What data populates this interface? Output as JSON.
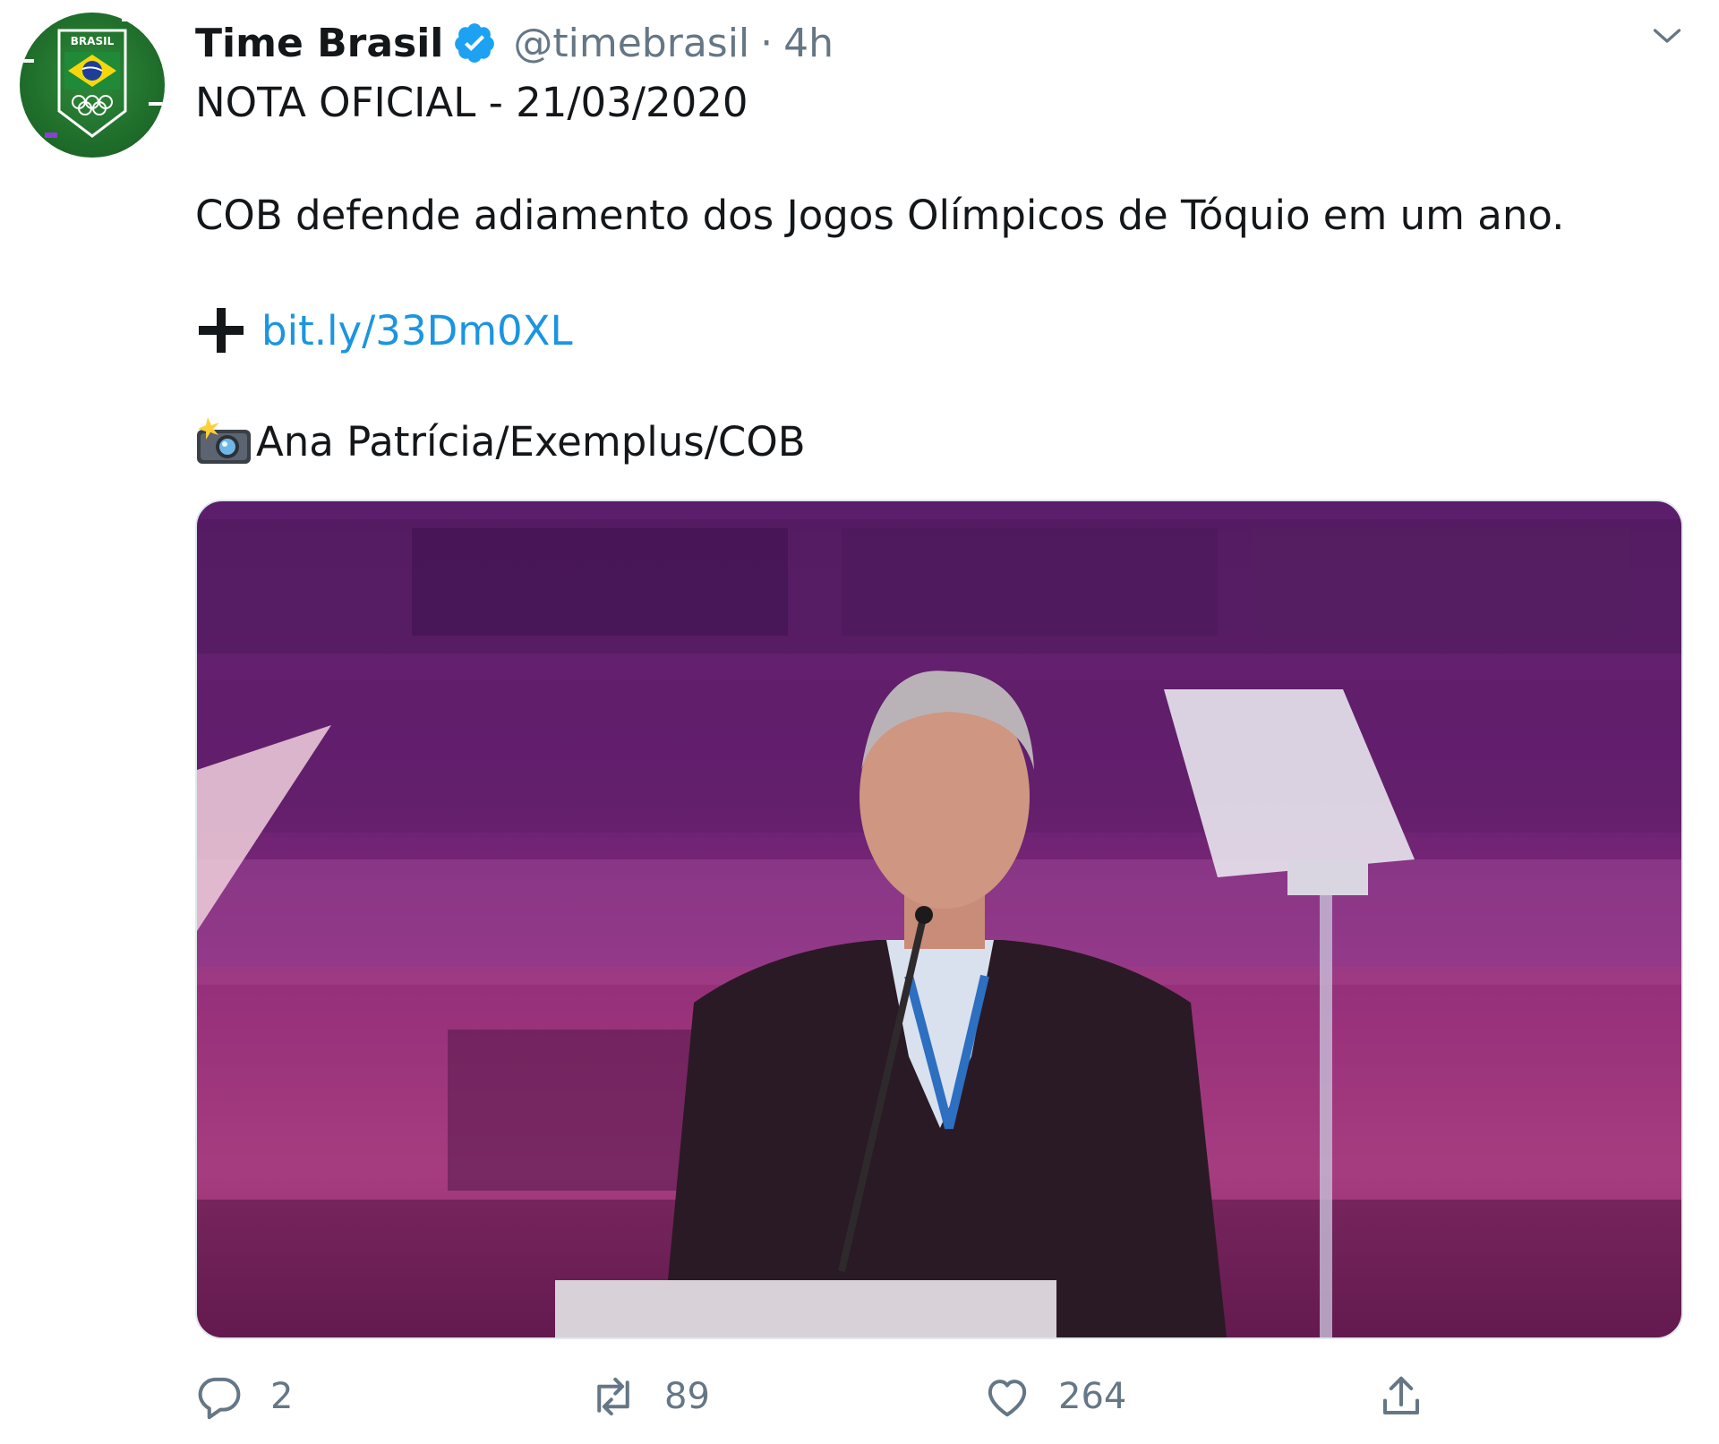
{
  "tweet": {
    "author": {
      "display_name": "Time Brasil",
      "handle": "@timebrasil",
      "separator": "·",
      "time": "4h",
      "avatar_text": "BRASIL",
      "verified": true
    },
    "lines": [
      "NOTA OFICIAL - 21/03/2020",
      "COB defende adiamento dos Jogos Olímpicos de Tóquio em um ano."
    ],
    "link_prefix_icon": "heavy-plus-icon",
    "link": "bit.ly/33Dm0XL",
    "credit_icon": "camera-flash-icon",
    "credit": "Ana Patrícia/Exemplus/COB",
    "media": {
      "icon": "photo-speaker-podium-icon"
    },
    "actions": {
      "reply_count": "2",
      "retweet_count": "89",
      "like_count": "264"
    }
  },
  "colors": {
    "text": "#14171a",
    "muted": "#657786",
    "link": "#1b95e0",
    "verified": "#1da1f2",
    "avatar_green": "#1f6e2b"
  }
}
